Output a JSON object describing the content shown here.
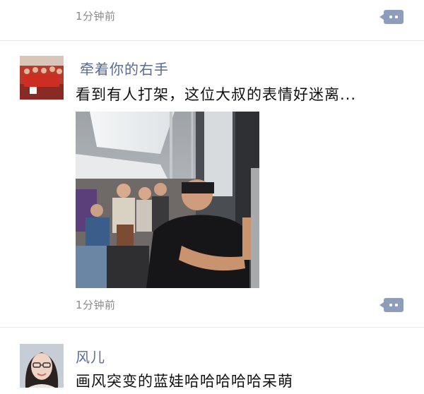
{
  "posts": [
    {
      "time": "1分钟前"
    },
    {
      "username": "牵着你的右手",
      "text": "看到有人打架，这位大叔的表情好迷离...",
      "time": "1分钟前"
    },
    {
      "username": "风儿",
      "text": "画风突变的蓝娃哈哈哈哈哈呆萌"
    }
  ],
  "icons": {
    "comment": "comment-bubble-icon"
  },
  "colors": {
    "username": "#576b95",
    "comment_button": "#8e9dbc",
    "time": "#8a8a8a"
  }
}
